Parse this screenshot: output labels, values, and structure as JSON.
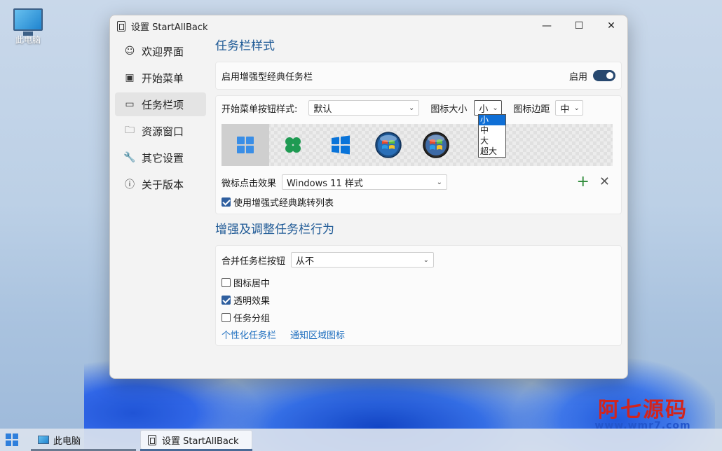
{
  "desktop": {
    "icon_label": "此电脑"
  },
  "window": {
    "title": "设置 StartAllBack",
    "controls": {
      "minimize": "—",
      "maximize": "☐",
      "close": "✕"
    }
  },
  "sidebar": {
    "items": [
      {
        "label": "欢迎界面",
        "icon": "smile-icon",
        "glyph": "☺"
      },
      {
        "label": "开始菜单",
        "icon": "start-menu-icon",
        "glyph": "▣"
      },
      {
        "label": "任务栏项",
        "icon": "taskbar-icon",
        "glyph": "▭",
        "active": true
      },
      {
        "label": "资源窗口",
        "icon": "folder-icon",
        "glyph": "🗀"
      },
      {
        "label": "其它设置",
        "icon": "wrench-icon",
        "glyph": "🔧"
      },
      {
        "label": "关于版本",
        "icon": "info-icon",
        "glyph": "ⓘ"
      }
    ]
  },
  "taskbar_style": {
    "section_title": "任务栏样式",
    "enhanced_classic_label": "启用增强型经典任务栏",
    "toggle_label": "启用",
    "toggle_on": true,
    "start_button_style_label": "开始菜单按钮样式:",
    "start_button_style_value": "默认",
    "icon_size_label": "图标大小",
    "icon_size_value": "小",
    "icon_size_options": [
      "小",
      "中",
      "大",
      "超大"
    ],
    "icon_margin_label": "图标边距",
    "icon_margin_value": "中",
    "click_effect_label": "微标点击效果",
    "click_effect_value": "Windows 11 样式",
    "jumplist_label": "使用增强式经典跳转列表",
    "jumplist_checked": true
  },
  "taskbar_behavior": {
    "section_title": "增强及调整任务栏行为",
    "combine_label": "合并任务栏按钮",
    "combine_value": "从不",
    "center_icons_label": "图标居中",
    "center_icons_checked": false,
    "transparency_label": "透明效果",
    "transparency_checked": true,
    "grouping_label": "任务分组",
    "grouping_checked": false,
    "link_personalize": "个性化任务栏",
    "link_notify": "通知区域图标"
  },
  "taskbar": {
    "items": [
      "此电脑",
      "设置 StartAllBack"
    ]
  },
  "watermark": {
    "title": "阿七源码",
    "url": "www.wmr7.com"
  },
  "colors": {
    "accent": "#1f5a96",
    "toggle": "#27486f",
    "add": "#2e8b3a",
    "remove": "#555555"
  }
}
